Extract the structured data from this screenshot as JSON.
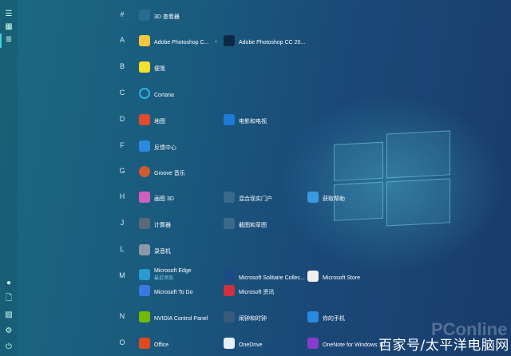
{
  "sidebar": {
    "items": [
      {
        "name": "hamburger-menu-icon",
        "glyph": "☰"
      },
      {
        "name": "tiles-icon",
        "glyph": "▦"
      },
      {
        "name": "all-apps-list-icon",
        "glyph": "≣"
      }
    ],
    "bottom": [
      {
        "name": "user-avatar",
        "glyph": "●"
      },
      {
        "name": "documents-icon",
        "glyph": "🗋"
      },
      {
        "name": "pictures-icon",
        "glyph": "▨"
      },
      {
        "name": "settings-gear-icon",
        "glyph": "⚙"
      },
      {
        "name": "power-icon",
        "glyph": "⏻"
      }
    ]
  },
  "sections": [
    {
      "letter": "#",
      "items": [
        {
          "col": 0,
          "label": "3D 查看器",
          "color": "#2a6a90"
        }
      ]
    },
    {
      "letter": "A",
      "items": [
        {
          "col": 0,
          "label": "Adobe Photoshop C...",
          "color": "#f5c640",
          "chevron": "⌄"
        },
        {
          "col": 1,
          "label": "Adobe Photoshop CC 20...",
          "color": "#0d2a44"
        }
      ]
    },
    {
      "letter": "B",
      "items": [
        {
          "col": 0,
          "label": "便笺",
          "color": "#f4e12a"
        }
      ]
    },
    {
      "letter": "C",
      "items": [
        {
          "col": 0,
          "label": "Cortana",
          "color": "#2ab0e8"
        }
      ]
    },
    {
      "letter": "D",
      "items": [
        {
          "col": 0,
          "label": "地图",
          "color": "#e04a2e"
        },
        {
          "col": 1,
          "label": "电影和电视",
          "color": "#1e7ad8"
        }
      ]
    },
    {
      "letter": "F",
      "items": [
        {
          "col": 0,
          "label": "反馈中心",
          "color": "#2a8ae0"
        }
      ]
    },
    {
      "letter": "G",
      "items": [
        {
          "col": 0,
          "label": "Groove 音乐",
          "color": "#d05a30"
        }
      ]
    },
    {
      "letter": "H",
      "items": [
        {
          "col": 0,
          "label": "画图 3D",
          "color": "#d060c0"
        },
        {
          "col": 1,
          "label": "混合现实门户",
          "color": "#3a6a8a"
        },
        {
          "col": 2,
          "label": "获取帮助",
          "color": "#3a9ae0"
        }
      ]
    },
    {
      "letter": "J",
      "items": [
        {
          "col": 0,
          "label": "计算器",
          "color": "#5a6a7a"
        },
        {
          "col": 1,
          "label": "截图和草图",
          "color": "#3a6a8a"
        }
      ]
    },
    {
      "letter": "L",
      "items": [
        {
          "col": 0,
          "label": "录音机",
          "color": "#8a9aa8"
        }
      ]
    },
    {
      "letter": "M",
      "items": [
        {
          "col": 0,
          "label": "Microsoft Edge",
          "sub": "最近添加",
          "color": "#2a9ad0"
        },
        {
          "col": 1,
          "label": "Microsoft Solitaire Collec...",
          "color": "#1a4a8a"
        },
        {
          "col": 2,
          "label": "Microsoft Store",
          "color": "#f0f0f0"
        },
        {
          "col": 0,
          "row2": true,
          "label": "Microsoft To Do",
          "color": "#3a7ae0"
        },
        {
          "col": 1,
          "row2": true,
          "label": "Microsoft 资讯",
          "color": "#d03040"
        }
      ]
    },
    {
      "letter": "N",
      "items": [
        {
          "col": 0,
          "label": "NVIDIA Control Panel",
          "color": "#76b900"
        },
        {
          "col": 1,
          "label": "闹钟和时钟",
          "color": "#3a5a7a"
        },
        {
          "col": 2,
          "label": "你的手机",
          "color": "#2a8ae0"
        }
      ]
    },
    {
      "letter": "O",
      "items": [
        {
          "col": 0,
          "label": "Office",
          "color": "#e04a20"
        },
        {
          "col": 1,
          "label": "OneDrive",
          "color": "#e8eef5"
        },
        {
          "col": 2,
          "label": "OneNote for Windows 10",
          "color": "#8a3ad0"
        }
      ]
    }
  ],
  "watermark": "百家号/太平洋电脑网",
  "watermark_logo": "PConline"
}
